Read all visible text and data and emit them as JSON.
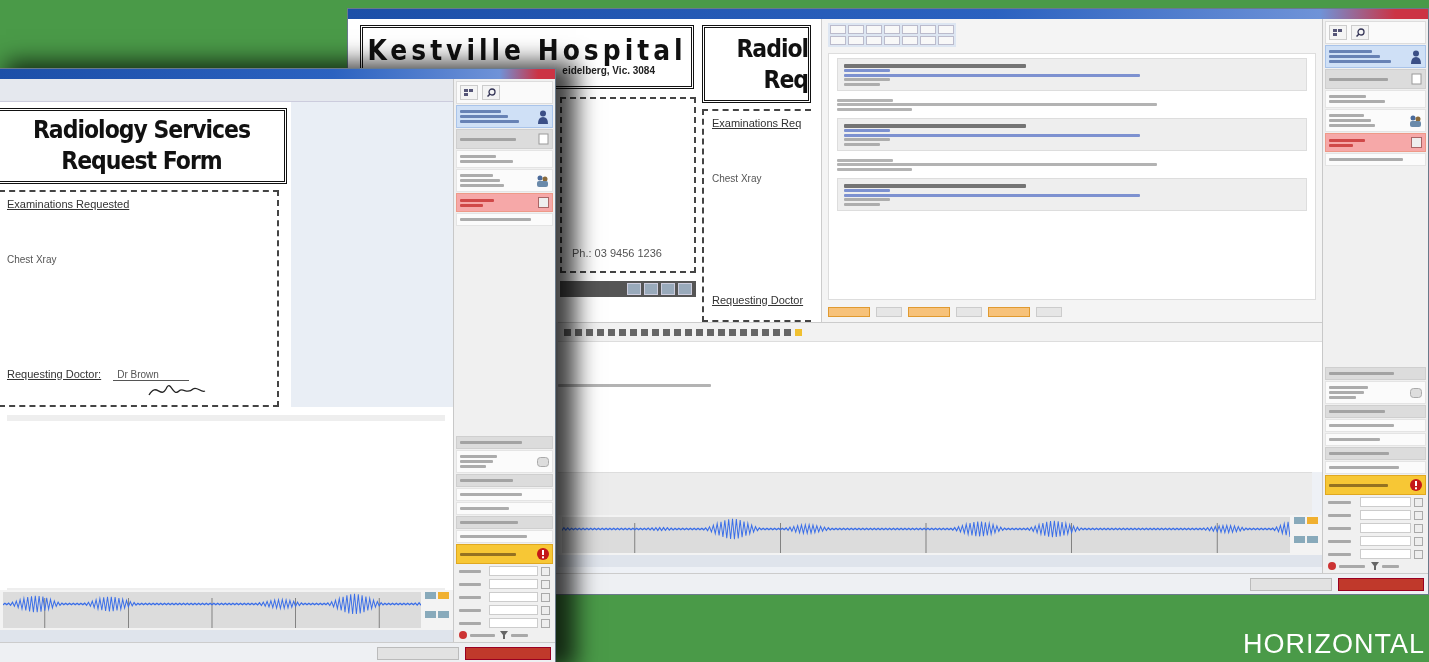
{
  "back_window": {
    "document": {
      "hospital_name": "Kestville Hospital",
      "address": "eidelberg, Vic. 3084",
      "phone": "Ph.: 03 9456 1236",
      "form_title_lines": [
        "Radiol",
        "Req"
      ],
      "exam_heading": "Examinations Req",
      "exam_item": "Chest Xray",
      "doctor_label": "Requesting Doctor"
    }
  },
  "front_window": {
    "document": {
      "form_title_lines": [
        "Radiology Services",
        "Request Form"
      ],
      "exam_heading": "Examinations Requested",
      "exam_item": "Chest Xray",
      "doctor_label": "Requesting Doctor:",
      "doctor_name": "Dr Brown"
    }
  },
  "background_caption": "HORIZONTAL"
}
